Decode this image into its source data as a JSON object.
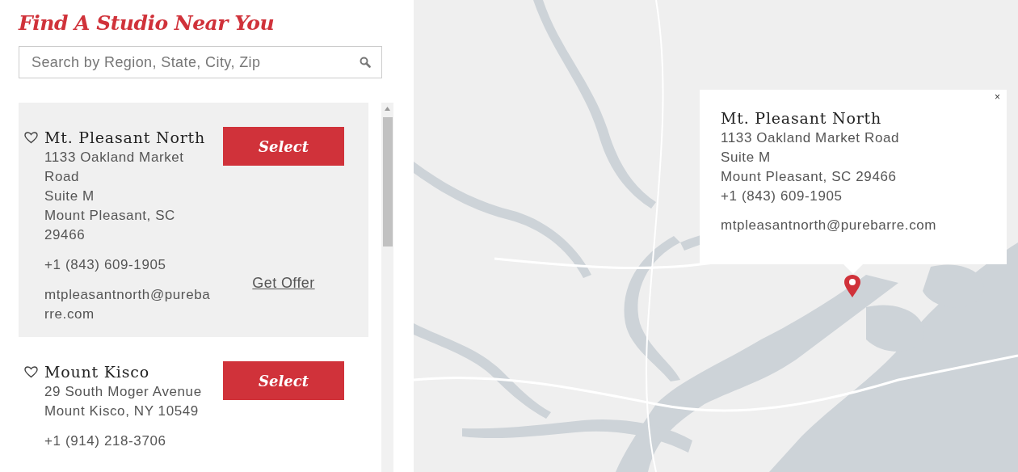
{
  "heading": "Find A Studio Near You",
  "search": {
    "placeholder": "Search by Region, State, City, Zip"
  },
  "studios": [
    {
      "name": "Mt. Pleasant North",
      "favorite": false,
      "selected": true,
      "address": [
        "1133 Oakland Market Road",
        "Suite M",
        "Mount Pleasant, SC 29466"
      ],
      "phone": "+1 (843) 609-1905",
      "email": "mtpleasantnorth@purebarre.com",
      "button": "Select",
      "offer": "Get Offer"
    },
    {
      "name": "Mount Kisco",
      "favorite": false,
      "selected": false,
      "address": [
        "29 South Moger Avenue",
        "Mount Kisco, NY 10549"
      ],
      "phone": "+1 (914) 218-3706",
      "button": "Select"
    }
  ],
  "map": {
    "kind": "picture",
    "popup": {
      "close": "×",
      "name": "Mt. Pleasant North",
      "lines": [
        "1133 Oakland Market Road",
        "Suite M",
        "Mount Pleasant, SC 29466",
        "+1 (843) 609-1905"
      ],
      "email": "mtpleasantnorth@purebarre.com"
    }
  }
}
